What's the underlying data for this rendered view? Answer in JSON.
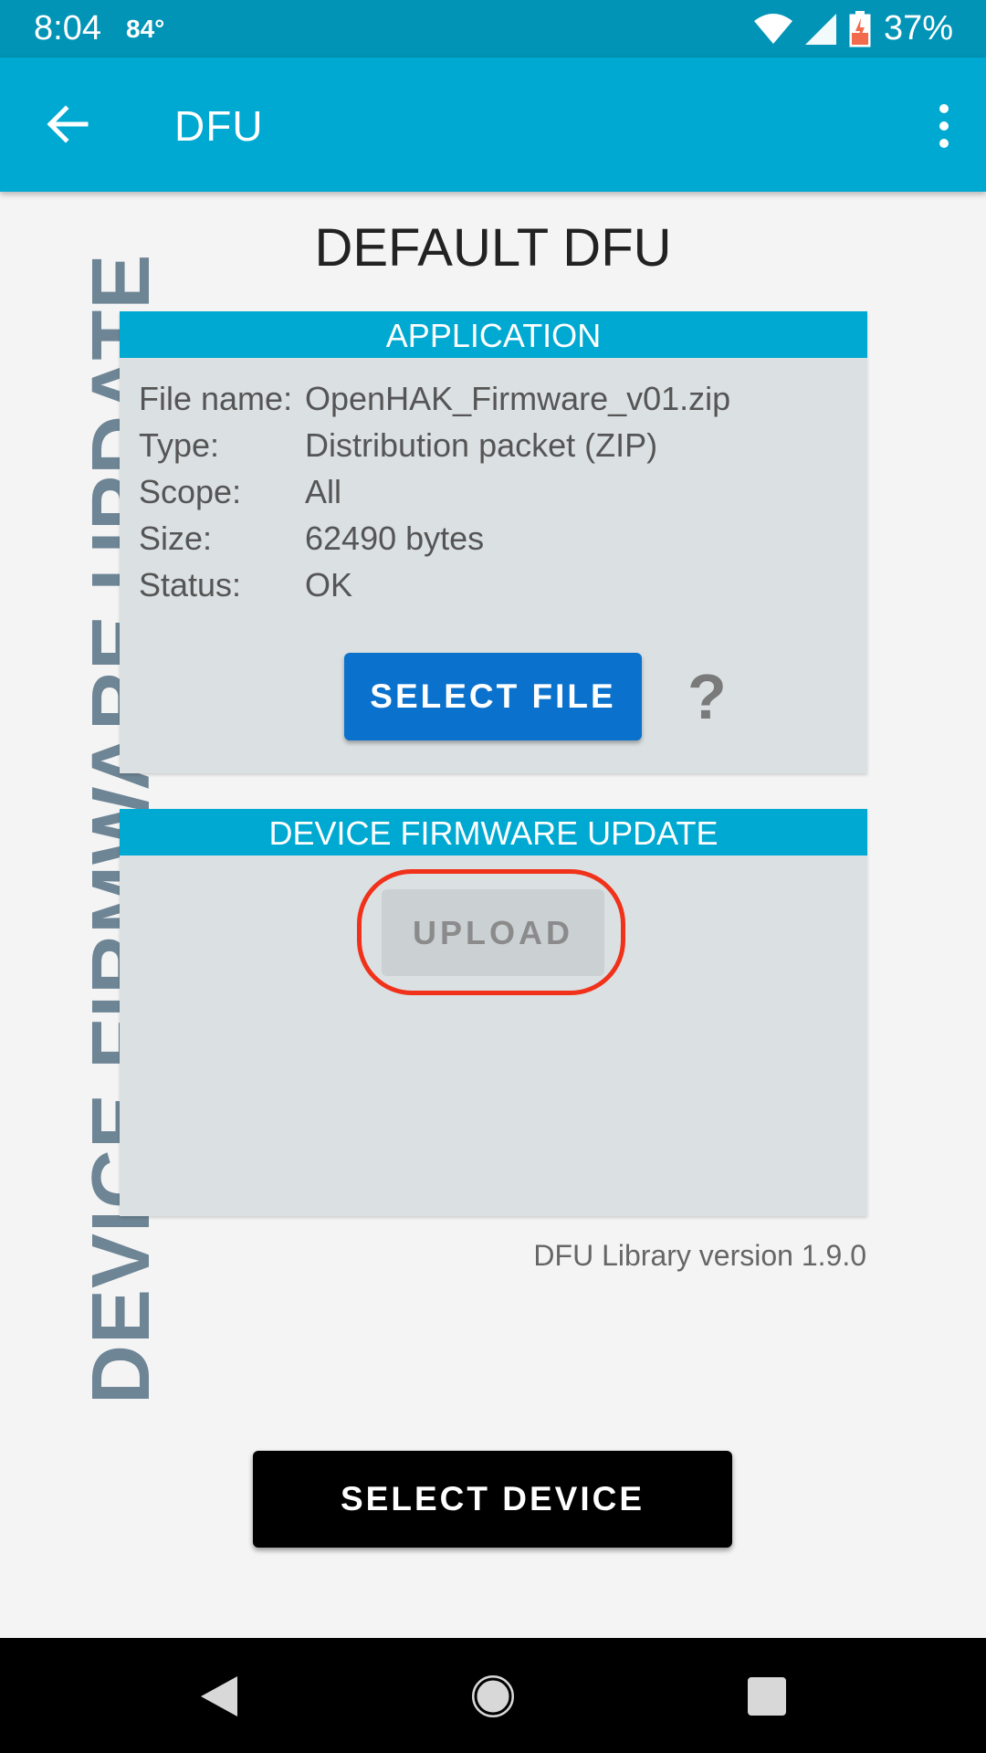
{
  "status_bar": {
    "time": "8:04",
    "temperature": "84°",
    "battery": "37%",
    "icons": [
      "wifi-icon",
      "signal-icon",
      "battery-charging-icon"
    ]
  },
  "app_bar": {
    "title": "DFU",
    "icons": [
      "back-arrow-icon",
      "overflow-menu-icon"
    ]
  },
  "side_title": "DEVICE FIRMWARE UPDATE",
  "main_title": "DEFAULT DFU",
  "application": {
    "header": "APPLICATION",
    "rows": [
      {
        "label": "File name:",
        "value": "OpenHAK_Firmware_v01.zip"
      },
      {
        "label": "Type:",
        "value": "Distribution packet (ZIP)"
      },
      {
        "label": "Scope:",
        "value": "All"
      },
      {
        "label": "Size:",
        "value": "62490 bytes"
      },
      {
        "label": "Status:",
        "value": "OK"
      }
    ],
    "select_file_label": "SELECT FILE",
    "help_label": "?"
  },
  "dfu": {
    "header": "DEVICE FIRMWARE UPDATE",
    "upload_label": "UPLOAD"
  },
  "library_version": "DFU Library version 1.9.0",
  "select_device_label": "SELECT DEVICE",
  "nav_bar": [
    "back-icon",
    "home-icon",
    "recents-icon"
  ],
  "colors": {
    "status_bar": "#0194b6",
    "app_bar": "#00a9d1",
    "primary_button": "#0a72cd",
    "highlight_ring": "#f0321a"
  }
}
